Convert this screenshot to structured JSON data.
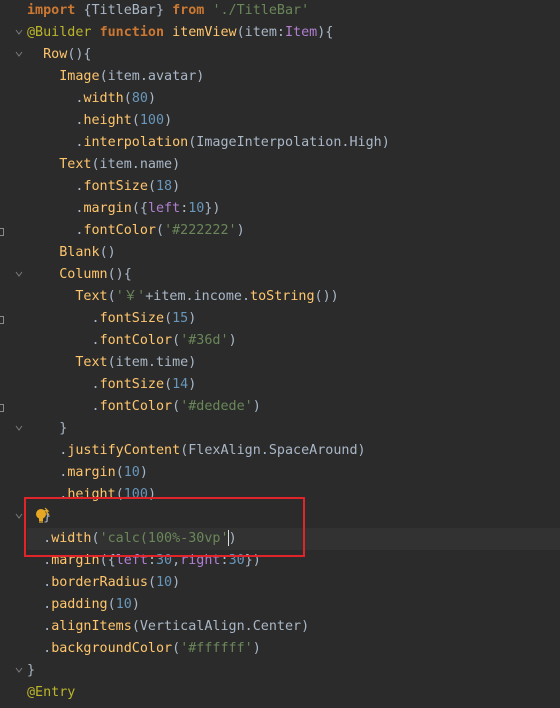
{
  "editor": {
    "lines": [
      {
        "tokens": [
          {
            "t": "import ",
            "c": "kw"
          },
          {
            "t": "{TitleBar} ",
            "c": "ident"
          },
          {
            "t": "from ",
            "c": "kw"
          },
          {
            "t": "'./TitleBar'",
            "c": "str"
          }
        ]
      },
      {
        "tokens": [
          {
            "t": "@Builder ",
            "c": "ann"
          },
          {
            "t": "function ",
            "c": "kw"
          },
          {
            "t": "itemView",
            "c": "tok-yellow"
          },
          {
            "t": "(item:",
            "c": "punc"
          },
          {
            "t": "Item",
            "c": "tok-purple"
          },
          {
            "t": "){",
            "c": "punc"
          }
        ]
      },
      {
        "tokens": [
          {
            "t": "  Row",
            "c": "tok-yellow"
          },
          {
            "t": "(){",
            "c": "punc"
          }
        ]
      },
      {
        "tokens": [
          {
            "t": "    Image",
            "c": "tok-yellow"
          },
          {
            "t": "(item.avatar)",
            "c": "punc"
          }
        ]
      },
      {
        "tokens": [
          {
            "t": "      .",
            "c": "punc"
          },
          {
            "t": "width",
            "c": "tok-yellow"
          },
          {
            "t": "(",
            "c": "punc"
          },
          {
            "t": "80",
            "c": "num"
          },
          {
            "t": ")",
            "c": "punc"
          }
        ]
      },
      {
        "tokens": [
          {
            "t": "      .",
            "c": "punc"
          },
          {
            "t": "height",
            "c": "tok-yellow"
          },
          {
            "t": "(",
            "c": "punc"
          },
          {
            "t": "100",
            "c": "num"
          },
          {
            "t": ")",
            "c": "punc"
          }
        ]
      },
      {
        "tokens": [
          {
            "t": "      .",
            "c": "punc"
          },
          {
            "t": "interpolation",
            "c": "tok-yellow"
          },
          {
            "t": "(ImageInterpolation.High)",
            "c": "punc"
          }
        ]
      },
      {
        "tokens": [
          {
            "t": "    Text",
            "c": "tok-yellow"
          },
          {
            "t": "(item.name)",
            "c": "punc"
          }
        ]
      },
      {
        "tokens": [
          {
            "t": "      .",
            "c": "punc"
          },
          {
            "t": "fontSize",
            "c": "tok-yellow"
          },
          {
            "t": "(",
            "c": "punc"
          },
          {
            "t": "18",
            "c": "num"
          },
          {
            "t": ")",
            "c": "punc"
          }
        ]
      },
      {
        "tokens": [
          {
            "t": "      .",
            "c": "punc"
          },
          {
            "t": "margin",
            "c": "tok-yellow"
          },
          {
            "t": "({",
            "c": "punc"
          },
          {
            "t": "left",
            "c": "tok-purple"
          },
          {
            "t": ":",
            "c": "punc"
          },
          {
            "t": "10",
            "c": "num"
          },
          {
            "t": "})",
            "c": "punc"
          }
        ]
      },
      {
        "tokens": [
          {
            "t": "      .",
            "c": "punc"
          },
          {
            "t": "fontColor",
            "c": "tok-yellow"
          },
          {
            "t": "(",
            "c": "punc"
          },
          {
            "t": "'#222222'",
            "c": "str"
          },
          {
            "t": ")",
            "c": "punc"
          }
        ]
      },
      {
        "tokens": [
          {
            "t": "    Blank",
            "c": "tok-yellow"
          },
          {
            "t": "()",
            "c": "punc"
          }
        ]
      },
      {
        "tokens": [
          {
            "t": "    Column",
            "c": "tok-yellow"
          },
          {
            "t": "(){",
            "c": "punc"
          }
        ]
      },
      {
        "tokens": [
          {
            "t": "      Text",
            "c": "tok-yellow"
          },
          {
            "t": "(",
            "c": "punc"
          },
          {
            "t": "'￥'",
            "c": "str"
          },
          {
            "t": "+item.income.",
            "c": "punc"
          },
          {
            "t": "toString",
            "c": "tok-yellow"
          },
          {
            "t": "())",
            "c": "punc"
          }
        ]
      },
      {
        "tokens": [
          {
            "t": "        .",
            "c": "punc"
          },
          {
            "t": "fontSize",
            "c": "tok-yellow"
          },
          {
            "t": "(",
            "c": "punc"
          },
          {
            "t": "15",
            "c": "num"
          },
          {
            "t": ")",
            "c": "punc"
          }
        ]
      },
      {
        "tokens": [
          {
            "t": "        .",
            "c": "punc"
          },
          {
            "t": "fontColor",
            "c": "tok-yellow"
          },
          {
            "t": "(",
            "c": "punc"
          },
          {
            "t": "'#36d'",
            "c": "str"
          },
          {
            "t": ")",
            "c": "punc"
          }
        ]
      },
      {
        "tokens": [
          {
            "t": "      Text",
            "c": "tok-yellow"
          },
          {
            "t": "(item.time)",
            "c": "punc"
          }
        ]
      },
      {
        "tokens": [
          {
            "t": "        .",
            "c": "punc"
          },
          {
            "t": "fontSize",
            "c": "tok-yellow"
          },
          {
            "t": "(",
            "c": "punc"
          },
          {
            "t": "14",
            "c": "num"
          },
          {
            "t": ")",
            "c": "punc"
          }
        ]
      },
      {
        "tokens": [
          {
            "t": "        .",
            "c": "punc"
          },
          {
            "t": "fontColor",
            "c": "tok-yellow"
          },
          {
            "t": "(",
            "c": "punc"
          },
          {
            "t": "'#dedede'",
            "c": "str"
          },
          {
            "t": ")",
            "c": "punc"
          }
        ]
      },
      {
        "tokens": [
          {
            "t": "    }",
            "c": "punc"
          }
        ]
      },
      {
        "tokens": [
          {
            "t": "    .",
            "c": "punc"
          },
          {
            "t": "justifyContent",
            "c": "tok-yellow"
          },
          {
            "t": "(FlexAlign.SpaceAround)",
            "c": "punc"
          }
        ]
      },
      {
        "tokens": [
          {
            "t": "    .",
            "c": "punc"
          },
          {
            "t": "margin",
            "c": "tok-yellow"
          },
          {
            "t": "(",
            "c": "punc"
          },
          {
            "t": "10",
            "c": "num"
          },
          {
            "t": ")",
            "c": "punc"
          }
        ]
      },
      {
        "tokens": [
          {
            "t": "    .",
            "c": "punc"
          },
          {
            "t": "height",
            "c": "tok-yellow"
          },
          {
            "t": "(",
            "c": "punc"
          },
          {
            "t": "100",
            "c": "num"
          },
          {
            "t": ")",
            "c": "punc"
          }
        ]
      },
      {
        "tokens": [
          {
            "t": "  }",
            "c": "punc"
          }
        ]
      },
      {
        "tokens": [
          {
            "t": "  .",
            "c": "punc"
          },
          {
            "t": "width",
            "c": "tok-yellow"
          },
          {
            "t": "(",
            "c": "punc"
          },
          {
            "t": "'calc(100%-30vp'",
            "c": "str"
          },
          {
            "t": ")",
            "c": "punc"
          }
        ]
      },
      {
        "tokens": [
          {
            "t": "  .",
            "c": "punc"
          },
          {
            "t": "margin",
            "c": "tok-yellow"
          },
          {
            "t": "({",
            "c": "punc"
          },
          {
            "t": "left",
            "c": "tok-purple"
          },
          {
            "t": ":",
            "c": "punc"
          },
          {
            "t": "30",
            "c": "num"
          },
          {
            "t": ",",
            "c": "punc"
          },
          {
            "t": "right",
            "c": "tok-purple"
          },
          {
            "t": ":",
            "c": "punc"
          },
          {
            "t": "30",
            "c": "num"
          },
          {
            "t": "})",
            "c": "punc"
          }
        ]
      },
      {
        "tokens": [
          {
            "t": "  .",
            "c": "punc"
          },
          {
            "t": "borderRadius",
            "c": "tok-yellow"
          },
          {
            "t": "(",
            "c": "punc"
          },
          {
            "t": "10",
            "c": "num"
          },
          {
            "t": ")",
            "c": "punc"
          }
        ]
      },
      {
        "tokens": [
          {
            "t": "  .",
            "c": "punc"
          },
          {
            "t": "padding",
            "c": "tok-yellow"
          },
          {
            "t": "(",
            "c": "punc"
          },
          {
            "t": "10",
            "c": "num"
          },
          {
            "t": ")",
            "c": "punc"
          }
        ]
      },
      {
        "tokens": [
          {
            "t": "  .",
            "c": "punc"
          },
          {
            "t": "alignItems",
            "c": "tok-yellow"
          },
          {
            "t": "(VerticalAlign.Center)",
            "c": "punc"
          }
        ]
      },
      {
        "tokens": [
          {
            "t": "  .",
            "c": "punc"
          },
          {
            "t": "backgroundColor",
            "c": "tok-yellow"
          },
          {
            "t": "(",
            "c": "punc"
          },
          {
            "t": "'#ffffff'",
            "c": "str"
          },
          {
            "t": ")",
            "c": "punc"
          }
        ]
      },
      {
        "tokens": [
          {
            "t": "}",
            "c": "punc"
          }
        ]
      },
      {
        "tokens": [
          {
            "t": "@Entry",
            "c": "ann"
          }
        ]
      }
    ]
  },
  "colors": {
    "background": "#2b2b2b",
    "current_line": "#323232",
    "highlight_box": "#e0242a"
  },
  "icons": {
    "lightbulb": "intention-bulb-icon",
    "fold": "fold-marker-icon"
  }
}
